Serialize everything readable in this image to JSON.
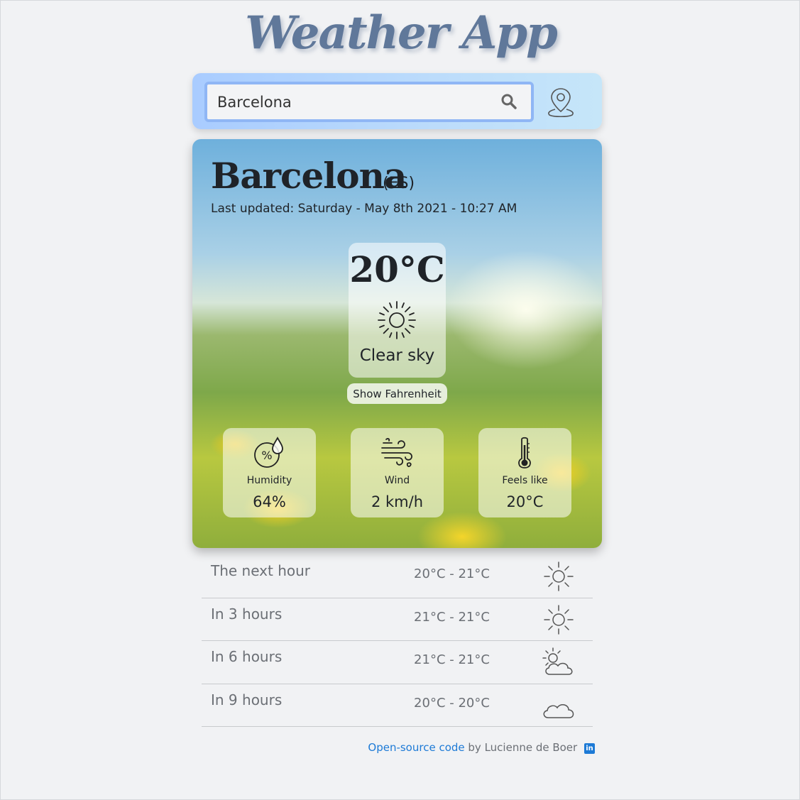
{
  "app_title": "Weather App",
  "search": {
    "value": "Barcelona",
    "placeholder": ""
  },
  "current": {
    "city": "Barcelona",
    "country": "(ES)",
    "last_updated": "Last updated: Saturday - May 8th 2021 - 10:27 AM",
    "temperature": "20°C",
    "condition": "Clear sky",
    "condition_icon": "sun-icon",
    "toggle_label": "Show Fahrenheit"
  },
  "details": [
    {
      "label": "Humidity",
      "value": "64%",
      "icon": "humidity-icon"
    },
    {
      "label": "Wind",
      "value": "2 km/h",
      "icon": "wind-icon"
    },
    {
      "label": "Feels like",
      "value": "20°C",
      "icon": "thermometer-icon"
    }
  ],
  "forecast": [
    {
      "label": "The next hour",
      "range": "20°C - 21°C",
      "icon": "sun-icon"
    },
    {
      "label": "In 3 hours",
      "range": "21°C - 21°C",
      "icon": "sun-icon"
    },
    {
      "label": "In 6 hours",
      "range": "21°C - 21°C",
      "icon": "partly-cloudy-icon"
    },
    {
      "label": "In 9 hours",
      "range": "20°C - 20°C",
      "icon": "cloud-icon"
    }
  ],
  "footer": {
    "link_text": "Open-source code",
    "by_text": "by Lucienne de Boer",
    "icon": "linkedin-icon",
    "icon_text": "in"
  },
  "colors": {
    "title": "#60789a",
    "accent": "#1d7ad6",
    "search_border": "#8fb6f5"
  }
}
